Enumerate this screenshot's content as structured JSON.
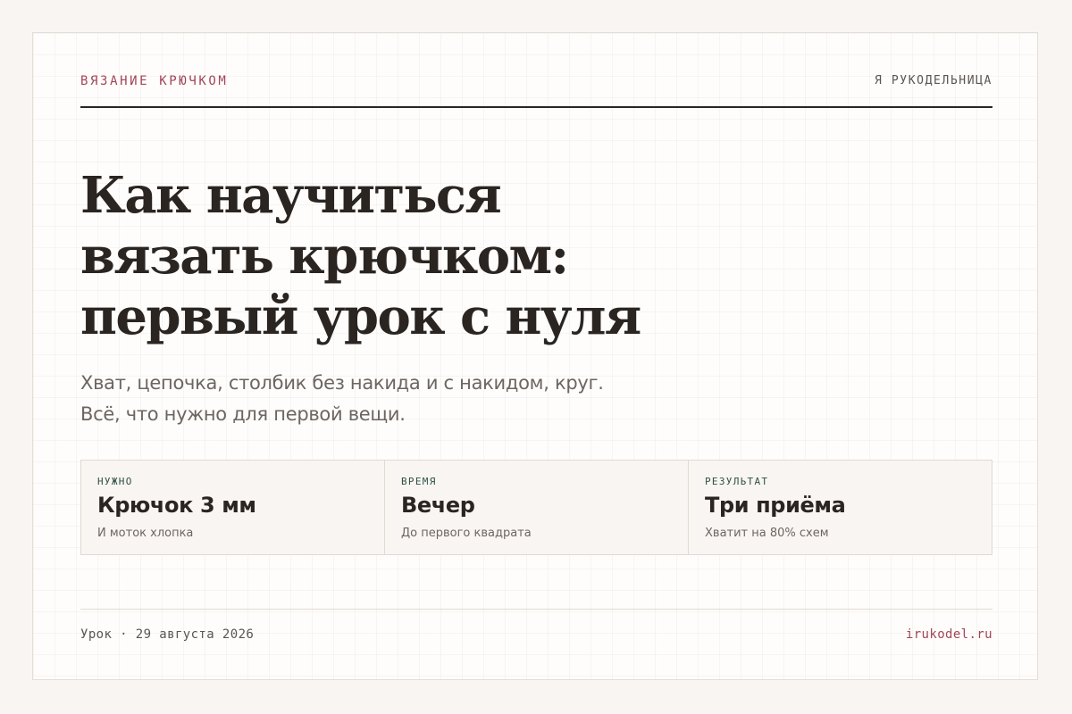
{
  "header": {
    "brand": "ВЯЗАНИЕ КРЮЧКОМ",
    "section": "Я РУКОДЕЛЬНИЦА"
  },
  "hero": {
    "title_lines": [
      "Как научиться",
      "вязать крючком:",
      "первый урок с нуля"
    ],
    "subtitle_lines": [
      "Хват, цепочка, столбик без накида и с накидом, круг.",
      "Всё, что нужно для первой вещи."
    ]
  },
  "facts": [
    {
      "label": "НУЖНО",
      "value": "Крючок 3 мм",
      "note": "И моток хлопка"
    },
    {
      "label": "ВРЕМЯ",
      "value": "Вечер",
      "note": "До первого квадрата"
    },
    {
      "label": "РЕЗУЛЬТАТ",
      "value": "Три приёма",
      "note": "Хватит на 80% схем"
    }
  ],
  "footer": {
    "meta": "Урок · 29 августа 2026",
    "link": "irukodel.ru"
  },
  "colors": {
    "accent": "#a14658",
    "text": "#2b2522",
    "label_green": "#2e5147",
    "muted": "#6d6560",
    "page_bg": "#f9f5f2"
  }
}
